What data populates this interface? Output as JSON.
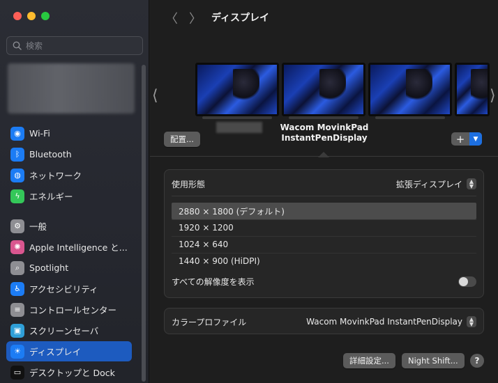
{
  "search": {
    "placeholder": "検索"
  },
  "sidebar": {
    "items": [
      {
        "label": "Wi-Fi",
        "icon": "wifi-icon",
        "color": "#1c7cf4",
        "glyph": "◉"
      },
      {
        "label": "Bluetooth",
        "icon": "bluetooth-icon",
        "color": "#1c7cf4",
        "glyph": "ᛒ"
      },
      {
        "label": "ネットワーク",
        "icon": "network-icon",
        "color": "#1c7cf4",
        "glyph": "◍"
      },
      {
        "label": "エネルギー",
        "icon": "energy-icon",
        "color": "#34c759",
        "glyph": "ϟ"
      },
      {
        "label": "一般",
        "icon": "gear-icon",
        "color": "#8e8e93",
        "glyph": "⚙"
      },
      {
        "label": "Apple Intelligence と...",
        "icon": "apple-intelligence-icon",
        "color": "#d9568f",
        "glyph": "✺"
      },
      {
        "label": "Spotlight",
        "icon": "magnifier-icon",
        "color": "#8e8e93",
        "glyph": "⌕"
      },
      {
        "label": "アクセシビリティ",
        "icon": "accessibility-icon",
        "color": "#1c7cf4",
        "glyph": "♿"
      },
      {
        "label": "コントロールセンター",
        "icon": "control-center-icon",
        "color": "#8e8e93",
        "glyph": "≡"
      },
      {
        "label": "スクリーンセーバ",
        "icon": "screensaver-icon",
        "color": "#2f9fd8",
        "glyph": "▣"
      },
      {
        "label": "ディスプレイ",
        "icon": "display-sun-icon",
        "color": "#1c7cf4",
        "glyph": "☀"
      },
      {
        "label": "デスクトップと Dock",
        "icon": "desktop-dock-icon",
        "color": "#111111",
        "glyph": "▭"
      }
    ],
    "active_index": 10
  },
  "header": {
    "title": "ディスプレイ",
    "back_icon": "chevron-left-icon",
    "forward_icon": "chevron-right-icon"
  },
  "arrangement": {
    "arrange_button": "配置...",
    "display_name_line1": "Wacom MovinkPad",
    "display_name_line2": "InstantPenDisplay",
    "add_label": "+",
    "monitor_count": 4
  },
  "usage": {
    "label": "使用形態",
    "value": "拡張ディスプレイ"
  },
  "resolutions": {
    "options": [
      "2880 × 1800 (デフォルト)",
      "1920 × 1200",
      "1024 × 640",
      "1440 × 900 (HiDPI)"
    ],
    "selected_index": 0,
    "show_all_label": "すべての解像度を表示",
    "show_all_enabled": false
  },
  "color_profile": {
    "label": "カラープロファイル",
    "value": "Wacom MovinkPad InstantPenDisplay"
  },
  "footer": {
    "advanced_button": "詳細設定...",
    "night_shift_button": "Night Shift...",
    "help_label": "?"
  }
}
